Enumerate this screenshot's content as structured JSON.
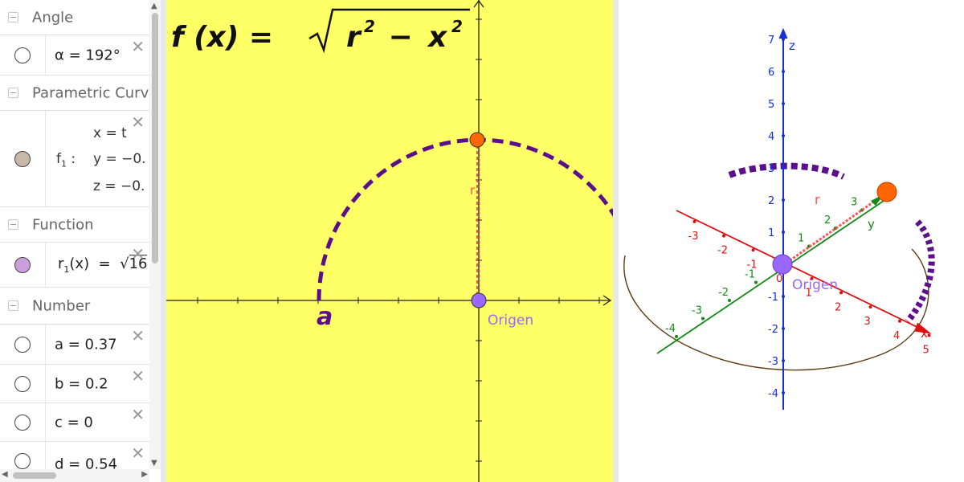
{
  "algebra": {
    "groups": [
      {
        "title": "Angle"
      },
      {
        "title": "Parametric Curv"
      },
      {
        "title": "Function"
      },
      {
        "title": "Number"
      }
    ],
    "angle_item": {
      "expr": "α = 192°",
      "color": "#ffffff"
    },
    "param_item": {
      "name": "f",
      "sub": "1",
      "colon": " :",
      "x_line": "x = t",
      "y_line": "y = −0.",
      "z_line": "z = −0.",
      "color": "#c8b8a8"
    },
    "function_item": {
      "name": "r",
      "sub": "1",
      "args": "(x)  =  ",
      "sqrt": "√",
      "radicand": "16",
      "color": "#c9a0dc"
    },
    "numbers": [
      {
        "expr": "a = 0.37"
      },
      {
        "expr": "b = 0.2"
      },
      {
        "expr": "c = 0"
      },
      {
        "expr": "d = 0.54"
      }
    ],
    "close_glyph": "✕"
  },
  "graphics2d": {
    "background": "#ffff66",
    "formula": {
      "lhs": "f (x) = ",
      "radicand_r": "r",
      "sup": "2",
      "minus": " − ",
      "radicand_x": "x",
      "sup2": "2"
    },
    "radius_label": "r",
    "a_label": "a",
    "origin_label": "Origen",
    "curve_color": "#5c0f8b",
    "top_point_color": "#ff6600",
    "origin_color": "#9966ff",
    "radius_color": "#ff5050"
  },
  "graphics3d": {
    "axis_labels": {
      "x": "x",
      "y": "y",
      "z": "z"
    },
    "radius_label": "r",
    "origin_label": "Origen",
    "z_ticks": [
      "7",
      "6",
      "5",
      "4",
      "3",
      "2",
      "1",
      "-1",
      "-2",
      "-3",
      "-4"
    ],
    "x_ticks": [
      "-3",
      "-2",
      "-1",
      "0",
      "1",
      "2",
      "3",
      "4",
      "5"
    ],
    "y_ticks": [
      "-4",
      "-3",
      "-2",
      "-1",
      "1",
      "2",
      "3"
    ],
    "x_color": "#e01010",
    "y_color": "#138a13",
    "z_color": "#1530d8",
    "curve_color": "#5c0f8b",
    "circle_color": "#5a3a10",
    "point_color": "#ff6600",
    "origin_color": "#9966ff"
  }
}
